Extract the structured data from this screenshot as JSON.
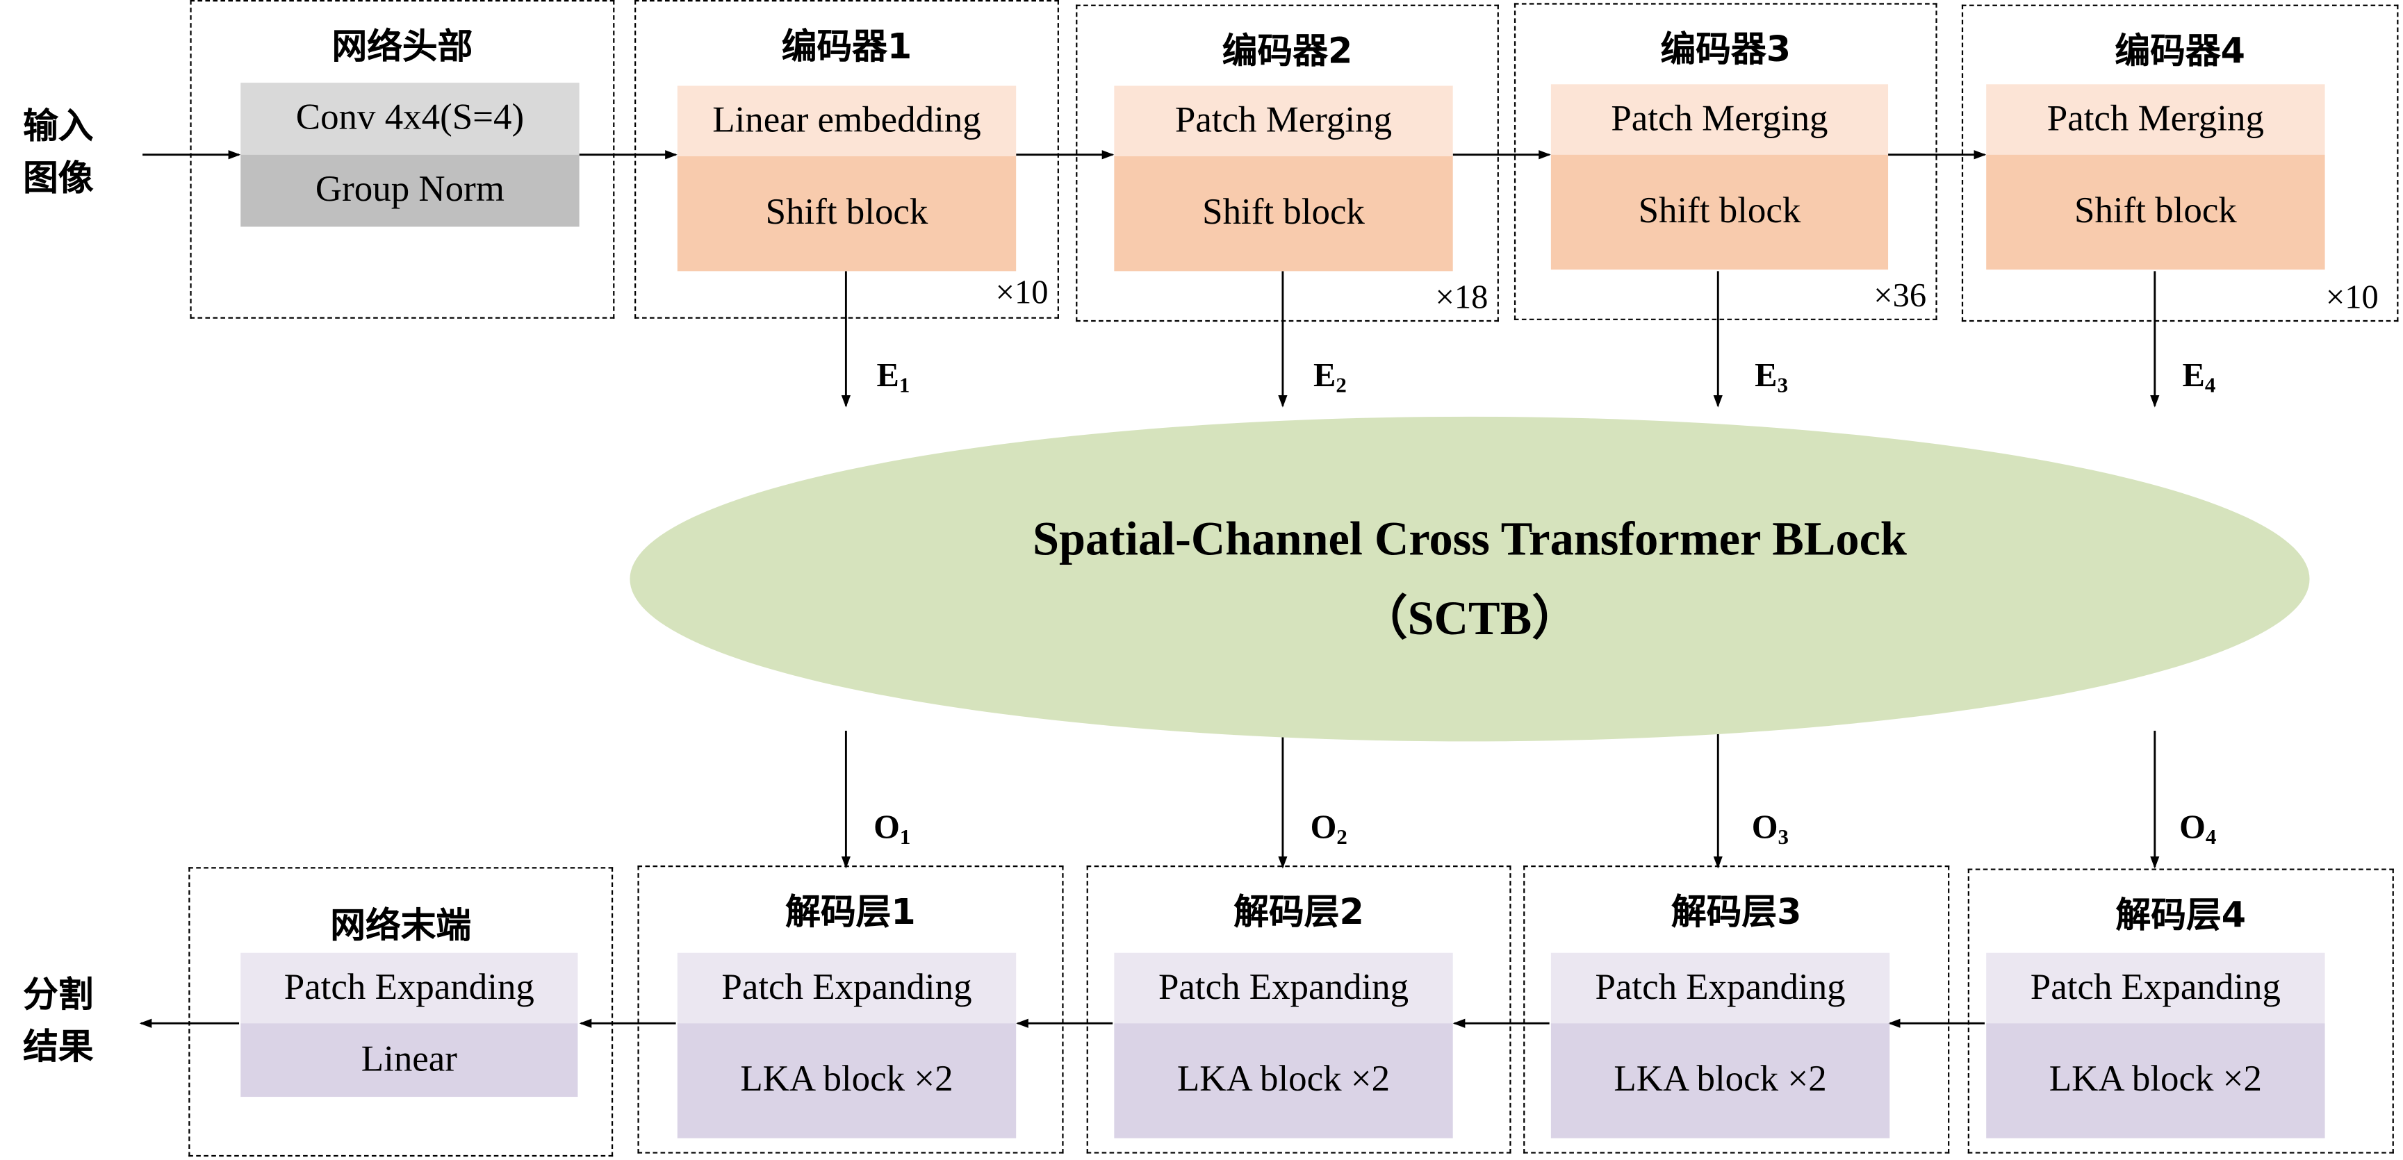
{
  "input_label": "输入\n图像",
  "output_label": "分割\n结果",
  "head": {
    "title": "网络头部",
    "block1": "Conv 4x4(S=4)",
    "block2": "Group Norm"
  },
  "encoders": [
    {
      "title": "编码器1",
      "block1": "Linear embedding",
      "block2": "Shift block",
      "repeat": "×10",
      "out": "E",
      "sub": "1"
    },
    {
      "title": "编码器2",
      "block1": "Patch Merging",
      "block2": "Shift block",
      "repeat": "×18",
      "out": "E",
      "sub": "2"
    },
    {
      "title": "编码器3",
      "block1": "Patch Merging",
      "block2": "Shift block",
      "repeat": "×36",
      "out": "E",
      "sub": "3"
    },
    {
      "title": "编码器4",
      "block1": "Patch Merging",
      "block2": "Shift block",
      "repeat": "×10",
      "out": "E",
      "sub": "4"
    }
  ],
  "sctb": {
    "line1": "Spatial-Channel Cross Transformer BLock",
    "line2": "（SCTB）"
  },
  "decoders": [
    {
      "title": "解码层1",
      "block1": "Patch Expanding",
      "block2": "LKA block ×2",
      "in": "O",
      "sub": "1"
    },
    {
      "title": "解码层2",
      "block1": "Patch Expanding",
      "block2": "LKA block ×2",
      "in": "O",
      "sub": "2"
    },
    {
      "title": "解码层3",
      "block1": "Patch Expanding",
      "block2": "LKA block ×2",
      "in": "O",
      "sub": "3"
    },
    {
      "title": "解码层4",
      "block1": "Patch Expanding",
      "block2": "LKA block ×2",
      "in": "O",
      "sub": "4"
    }
  ],
  "tail": {
    "title": "网络末端",
    "block1": "Patch Expanding",
    "block2": "Linear"
  },
  "colors": {
    "head_top": "#d9d9d9",
    "head_bottom": "#bfbfbf",
    "enc_top": "#fce4d6",
    "enc_bottom": "#f8cbad",
    "dec_top": "#ebe7f1",
    "dec_bottom": "#dad3e6",
    "sctb": "#d6e3bd"
  }
}
